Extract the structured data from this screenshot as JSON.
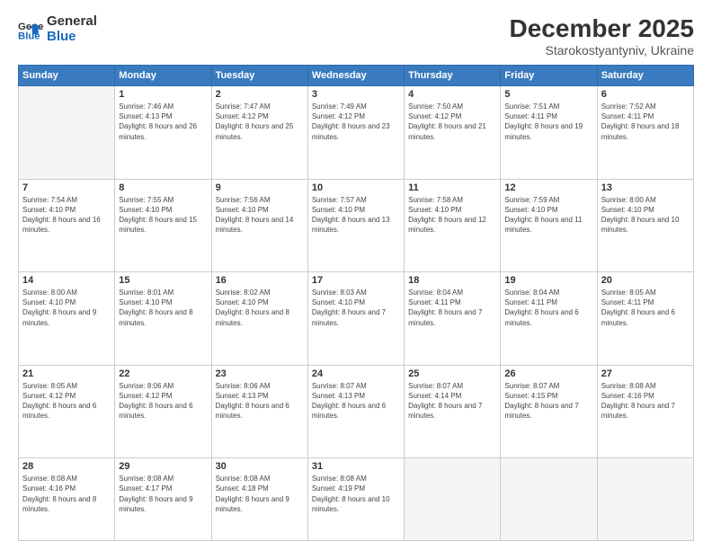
{
  "logo": {
    "text_general": "General",
    "text_blue": "Blue"
  },
  "header": {
    "title": "December 2025",
    "subtitle": "Starokostyantyniv, Ukraine"
  },
  "weekdays": [
    "Sunday",
    "Monday",
    "Tuesday",
    "Wednesday",
    "Thursday",
    "Friday",
    "Saturday"
  ],
  "weeks": [
    [
      {
        "day": "",
        "empty": true
      },
      {
        "day": "1",
        "sunrise": "7:46 AM",
        "sunset": "4:13 PM",
        "daylight": "8 hours and 26 minutes."
      },
      {
        "day": "2",
        "sunrise": "7:47 AM",
        "sunset": "4:12 PM",
        "daylight": "8 hours and 25 minutes."
      },
      {
        "day": "3",
        "sunrise": "7:49 AM",
        "sunset": "4:12 PM",
        "daylight": "8 hours and 23 minutes."
      },
      {
        "day": "4",
        "sunrise": "7:50 AM",
        "sunset": "4:12 PM",
        "daylight": "8 hours and 21 minutes."
      },
      {
        "day": "5",
        "sunrise": "7:51 AM",
        "sunset": "4:11 PM",
        "daylight": "8 hours and 19 minutes."
      },
      {
        "day": "6",
        "sunrise": "7:52 AM",
        "sunset": "4:11 PM",
        "daylight": "8 hours and 18 minutes."
      }
    ],
    [
      {
        "day": "7",
        "sunrise": "7:54 AM",
        "sunset": "4:10 PM",
        "daylight": "8 hours and 16 minutes."
      },
      {
        "day": "8",
        "sunrise": "7:55 AM",
        "sunset": "4:10 PM",
        "daylight": "8 hours and 15 minutes."
      },
      {
        "day": "9",
        "sunrise": "7:56 AM",
        "sunset": "4:10 PM",
        "daylight": "8 hours and 14 minutes."
      },
      {
        "day": "10",
        "sunrise": "7:57 AM",
        "sunset": "4:10 PM",
        "daylight": "8 hours and 13 minutes."
      },
      {
        "day": "11",
        "sunrise": "7:58 AM",
        "sunset": "4:10 PM",
        "daylight": "8 hours and 12 minutes."
      },
      {
        "day": "12",
        "sunrise": "7:59 AM",
        "sunset": "4:10 PM",
        "daylight": "8 hours and 11 minutes."
      },
      {
        "day": "13",
        "sunrise": "8:00 AM",
        "sunset": "4:10 PM",
        "daylight": "8 hours and 10 minutes."
      }
    ],
    [
      {
        "day": "14",
        "sunrise": "8:00 AM",
        "sunset": "4:10 PM",
        "daylight": "8 hours and 9 minutes."
      },
      {
        "day": "15",
        "sunrise": "8:01 AM",
        "sunset": "4:10 PM",
        "daylight": "8 hours and 8 minutes."
      },
      {
        "day": "16",
        "sunrise": "8:02 AM",
        "sunset": "4:10 PM",
        "daylight": "8 hours and 8 minutes."
      },
      {
        "day": "17",
        "sunrise": "8:03 AM",
        "sunset": "4:10 PM",
        "daylight": "8 hours and 7 minutes."
      },
      {
        "day": "18",
        "sunrise": "8:04 AM",
        "sunset": "4:11 PM",
        "daylight": "8 hours and 7 minutes."
      },
      {
        "day": "19",
        "sunrise": "8:04 AM",
        "sunset": "4:11 PM",
        "daylight": "8 hours and 6 minutes."
      },
      {
        "day": "20",
        "sunrise": "8:05 AM",
        "sunset": "4:11 PM",
        "daylight": "8 hours and 6 minutes."
      }
    ],
    [
      {
        "day": "21",
        "sunrise": "8:05 AM",
        "sunset": "4:12 PM",
        "daylight": "8 hours and 6 minutes."
      },
      {
        "day": "22",
        "sunrise": "8:06 AM",
        "sunset": "4:12 PM",
        "daylight": "8 hours and 6 minutes."
      },
      {
        "day": "23",
        "sunrise": "8:06 AM",
        "sunset": "4:13 PM",
        "daylight": "8 hours and 6 minutes."
      },
      {
        "day": "24",
        "sunrise": "8:07 AM",
        "sunset": "4:13 PM",
        "daylight": "8 hours and 6 minutes."
      },
      {
        "day": "25",
        "sunrise": "8:07 AM",
        "sunset": "4:14 PM",
        "daylight": "8 hours and 7 minutes."
      },
      {
        "day": "26",
        "sunrise": "8:07 AM",
        "sunset": "4:15 PM",
        "daylight": "8 hours and 7 minutes."
      },
      {
        "day": "27",
        "sunrise": "8:08 AM",
        "sunset": "4:16 PM",
        "daylight": "8 hours and 7 minutes."
      }
    ],
    [
      {
        "day": "28",
        "sunrise": "8:08 AM",
        "sunset": "4:16 PM",
        "daylight": "8 hours and 8 minutes."
      },
      {
        "day": "29",
        "sunrise": "8:08 AM",
        "sunset": "4:17 PM",
        "daylight": "8 hours and 9 minutes."
      },
      {
        "day": "30",
        "sunrise": "8:08 AM",
        "sunset": "4:18 PM",
        "daylight": "8 hours and 9 minutes."
      },
      {
        "day": "31",
        "sunrise": "8:08 AM",
        "sunset": "4:19 PM",
        "daylight": "8 hours and 10 minutes."
      },
      {
        "day": "",
        "empty": true
      },
      {
        "day": "",
        "empty": true
      },
      {
        "day": "",
        "empty": true
      }
    ]
  ],
  "labels": {
    "sunrise": "Sunrise:",
    "sunset": "Sunset:",
    "daylight": "Daylight:"
  }
}
